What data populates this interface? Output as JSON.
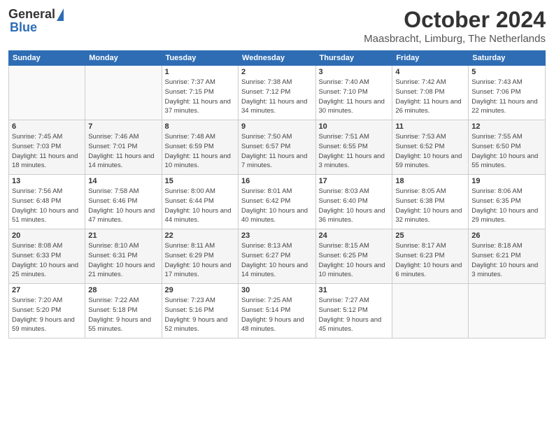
{
  "logo": {
    "general": "General",
    "blue": "Blue"
  },
  "title": "October 2024",
  "subtitle": "Maasbracht, Limburg, The Netherlands",
  "days_of_week": [
    "Sunday",
    "Monday",
    "Tuesday",
    "Wednesday",
    "Thursday",
    "Friday",
    "Saturday"
  ],
  "weeks": [
    [
      {
        "day": "",
        "detail": ""
      },
      {
        "day": "",
        "detail": ""
      },
      {
        "day": "1",
        "detail": "Sunrise: 7:37 AM\nSunset: 7:15 PM\nDaylight: 11 hours\nand 37 minutes."
      },
      {
        "day": "2",
        "detail": "Sunrise: 7:38 AM\nSunset: 7:12 PM\nDaylight: 11 hours\nand 34 minutes."
      },
      {
        "day": "3",
        "detail": "Sunrise: 7:40 AM\nSunset: 7:10 PM\nDaylight: 11 hours\nand 30 minutes."
      },
      {
        "day": "4",
        "detail": "Sunrise: 7:42 AM\nSunset: 7:08 PM\nDaylight: 11 hours\nand 26 minutes."
      },
      {
        "day": "5",
        "detail": "Sunrise: 7:43 AM\nSunset: 7:06 PM\nDaylight: 11 hours\nand 22 minutes."
      }
    ],
    [
      {
        "day": "6",
        "detail": "Sunrise: 7:45 AM\nSunset: 7:03 PM\nDaylight: 11 hours\nand 18 minutes."
      },
      {
        "day": "7",
        "detail": "Sunrise: 7:46 AM\nSunset: 7:01 PM\nDaylight: 11 hours\nand 14 minutes."
      },
      {
        "day": "8",
        "detail": "Sunrise: 7:48 AM\nSunset: 6:59 PM\nDaylight: 11 hours\nand 10 minutes."
      },
      {
        "day": "9",
        "detail": "Sunrise: 7:50 AM\nSunset: 6:57 PM\nDaylight: 11 hours\nand 7 minutes."
      },
      {
        "day": "10",
        "detail": "Sunrise: 7:51 AM\nSunset: 6:55 PM\nDaylight: 11 hours\nand 3 minutes."
      },
      {
        "day": "11",
        "detail": "Sunrise: 7:53 AM\nSunset: 6:52 PM\nDaylight: 10 hours\nand 59 minutes."
      },
      {
        "day": "12",
        "detail": "Sunrise: 7:55 AM\nSunset: 6:50 PM\nDaylight: 10 hours\nand 55 minutes."
      }
    ],
    [
      {
        "day": "13",
        "detail": "Sunrise: 7:56 AM\nSunset: 6:48 PM\nDaylight: 10 hours\nand 51 minutes."
      },
      {
        "day": "14",
        "detail": "Sunrise: 7:58 AM\nSunset: 6:46 PM\nDaylight: 10 hours\nand 47 minutes."
      },
      {
        "day": "15",
        "detail": "Sunrise: 8:00 AM\nSunset: 6:44 PM\nDaylight: 10 hours\nand 44 minutes."
      },
      {
        "day": "16",
        "detail": "Sunrise: 8:01 AM\nSunset: 6:42 PM\nDaylight: 10 hours\nand 40 minutes."
      },
      {
        "day": "17",
        "detail": "Sunrise: 8:03 AM\nSunset: 6:40 PM\nDaylight: 10 hours\nand 36 minutes."
      },
      {
        "day": "18",
        "detail": "Sunrise: 8:05 AM\nSunset: 6:38 PM\nDaylight: 10 hours\nand 32 minutes."
      },
      {
        "day": "19",
        "detail": "Sunrise: 8:06 AM\nSunset: 6:35 PM\nDaylight: 10 hours\nand 29 minutes."
      }
    ],
    [
      {
        "day": "20",
        "detail": "Sunrise: 8:08 AM\nSunset: 6:33 PM\nDaylight: 10 hours\nand 25 minutes."
      },
      {
        "day": "21",
        "detail": "Sunrise: 8:10 AM\nSunset: 6:31 PM\nDaylight: 10 hours\nand 21 minutes."
      },
      {
        "day": "22",
        "detail": "Sunrise: 8:11 AM\nSunset: 6:29 PM\nDaylight: 10 hours\nand 17 minutes."
      },
      {
        "day": "23",
        "detail": "Sunrise: 8:13 AM\nSunset: 6:27 PM\nDaylight: 10 hours\nand 14 minutes."
      },
      {
        "day": "24",
        "detail": "Sunrise: 8:15 AM\nSunset: 6:25 PM\nDaylight: 10 hours\nand 10 minutes."
      },
      {
        "day": "25",
        "detail": "Sunrise: 8:17 AM\nSunset: 6:23 PM\nDaylight: 10 hours\nand 6 minutes."
      },
      {
        "day": "26",
        "detail": "Sunrise: 8:18 AM\nSunset: 6:21 PM\nDaylight: 10 hours\nand 3 minutes."
      }
    ],
    [
      {
        "day": "27",
        "detail": "Sunrise: 7:20 AM\nSunset: 5:20 PM\nDaylight: 9 hours\nand 59 minutes."
      },
      {
        "day": "28",
        "detail": "Sunrise: 7:22 AM\nSunset: 5:18 PM\nDaylight: 9 hours\nand 55 minutes."
      },
      {
        "day": "29",
        "detail": "Sunrise: 7:23 AM\nSunset: 5:16 PM\nDaylight: 9 hours\nand 52 minutes."
      },
      {
        "day": "30",
        "detail": "Sunrise: 7:25 AM\nSunset: 5:14 PM\nDaylight: 9 hours\nand 48 minutes."
      },
      {
        "day": "31",
        "detail": "Sunrise: 7:27 AM\nSunset: 5:12 PM\nDaylight: 9 hours\nand 45 minutes."
      },
      {
        "day": "",
        "detail": ""
      },
      {
        "day": "",
        "detail": ""
      }
    ]
  ]
}
